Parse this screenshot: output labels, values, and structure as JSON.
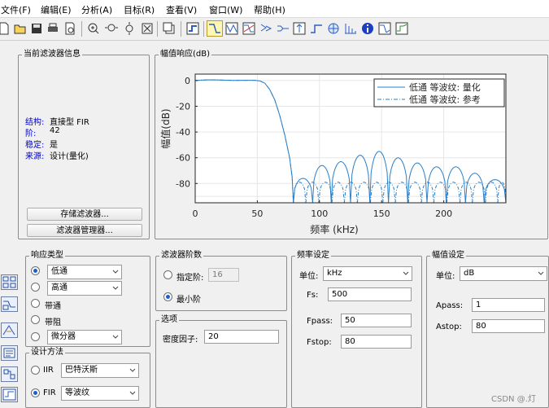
{
  "menubar": {
    "items": [
      "文件(F)",
      "编辑(E)",
      "分析(A)",
      "目标(R)",
      "查看(V)",
      "窗口(W)",
      "帮助(H)"
    ]
  },
  "toolbar": {
    "icons": [
      "new-icon",
      "open-icon",
      "save-icon",
      "print-icon",
      "print-preview-icon",
      "zoom-in-icon",
      "zoom-x-icon",
      "zoom-y-icon",
      "full-view-icon",
      "new-window-icon",
      "design-mode-icon",
      "magnitude-response-icon",
      "phase-response-icon",
      "magnitude-phase-icon",
      "group-delay-icon",
      "phase-delay-icon",
      "impulse-response-icon",
      "step-response-icon",
      "pole-zero-icon",
      "coefficients-icon",
      "info-icon",
      "noise-icon",
      "round-off-icon"
    ],
    "active": "magnitude-response-icon"
  },
  "filter_info": {
    "title": "当前滤波器信息",
    "rows": [
      {
        "key": "结构:",
        "value": "直接型 FIR"
      },
      {
        "key": "阶:",
        "value": "42"
      },
      {
        "key": "稳定:",
        "value": "是"
      },
      {
        "key": "来源:",
        "value": "设计(量化)"
      }
    ],
    "store_button": "存储滤波器...",
    "manager_button": "滤波器管理器..."
  },
  "plot_panel": {
    "title": "幅值响应(dB)"
  },
  "chart_data": {
    "type": "line",
    "xlabel": "频率 (kHz)",
    "ylabel": "幅值(dB)",
    "xlim": [
      0,
      250
    ],
    "ylim": [
      -95,
      5
    ],
    "xticks": [
      0,
      50,
      100,
      150,
      200
    ],
    "yticks": [
      0,
      -20,
      -40,
      -60,
      -80
    ],
    "grid": true,
    "legend_position": "top-right",
    "series": [
      {
        "name": "低通 等波纹: 量化",
        "style": "solid",
        "color": "#2a7fc9",
        "passband": [
          [
            0,
            0
          ],
          [
            5,
            0.3
          ],
          [
            12,
            0.6
          ],
          [
            20,
            0.4
          ],
          [
            30,
            0.1
          ],
          [
            40,
            0.2
          ],
          [
            48,
            0.2
          ],
          [
            52,
            -0.3
          ],
          [
            56,
            -2
          ],
          [
            60,
            -7
          ],
          [
            64,
            -15
          ],
          [
            68,
            -27
          ],
          [
            72,
            -42
          ],
          [
            76,
            -60
          ],
          [
            78,
            -75
          ],
          [
            79,
            -95
          ]
        ],
        "sidelobe_peaks": [
          [
            87,
            -76
          ],
          [
            102,
            -66
          ],
          [
            117,
            -63
          ],
          [
            133,
            -58
          ],
          [
            148,
            -55
          ],
          [
            163,
            -60
          ],
          [
            179,
            -64
          ],
          [
            194,
            -67
          ],
          [
            210,
            -67
          ],
          [
            225,
            -72
          ],
          [
            240,
            -77
          ]
        ]
      },
      {
        "name": "低通 等波纹: 参考",
        "style": "dashdot",
        "color": "#2a7fc9",
        "sidelobe_peaks": [
          [
            84,
            -79
          ],
          [
            94,
            -79
          ],
          [
            105,
            -79
          ],
          [
            115,
            -79
          ],
          [
            125,
            -79
          ],
          [
            136,
            -79
          ],
          [
            146,
            -79
          ],
          [
            156,
            -79
          ],
          [
            166,
            -79
          ],
          [
            177,
            -79
          ],
          [
            187,
            -79
          ],
          [
            197,
            -79
          ],
          [
            208,
            -79
          ],
          [
            218,
            -79
          ],
          [
            228,
            -79
          ],
          [
            239,
            -79
          ],
          [
            248,
            -79
          ]
        ]
      }
    ]
  },
  "response_type": {
    "title": "响应类型",
    "options": [
      {
        "label": "低通",
        "dropdown": true,
        "checked": true
      },
      {
        "label": "高通",
        "dropdown": true,
        "checked": false
      },
      {
        "label": "带通",
        "dropdown": false,
        "checked": false
      },
      {
        "label": "带阻",
        "dropdown": false,
        "checked": false
      },
      {
        "label": "微分器",
        "dropdown": true,
        "checked": false
      }
    ]
  },
  "design_method": {
    "title": "设计方法",
    "iir_label": "IIR",
    "iir_select": "巴特沃斯",
    "fir_label": "FIR",
    "fir_select": "等波纹",
    "selected": "FIR"
  },
  "filter_order": {
    "title": "滤波器阶数",
    "specify_label": "指定阶:",
    "specify_value": "16",
    "minimum_label": "最小阶",
    "selected": "minimum"
  },
  "options": {
    "title": "选项",
    "density_label": "密度因子:",
    "density_value": "20"
  },
  "freq_spec": {
    "title": "频率设定",
    "unit_label": "单位:",
    "unit_value": "kHz",
    "fs_label": "Fs:",
    "fs_value": "500",
    "fpass_label": "Fpass:",
    "fpass_value": "50",
    "fstop_label": "Fstop:",
    "fstop_value": "80"
  },
  "mag_spec": {
    "title": "幅值设定",
    "unit_label": "单位:",
    "unit_value": "dB",
    "apass_label": "Apass:",
    "apass_value": "1",
    "astop_label": "Astop:",
    "astop_value": "80"
  },
  "watermark": "CSDN @.灯"
}
